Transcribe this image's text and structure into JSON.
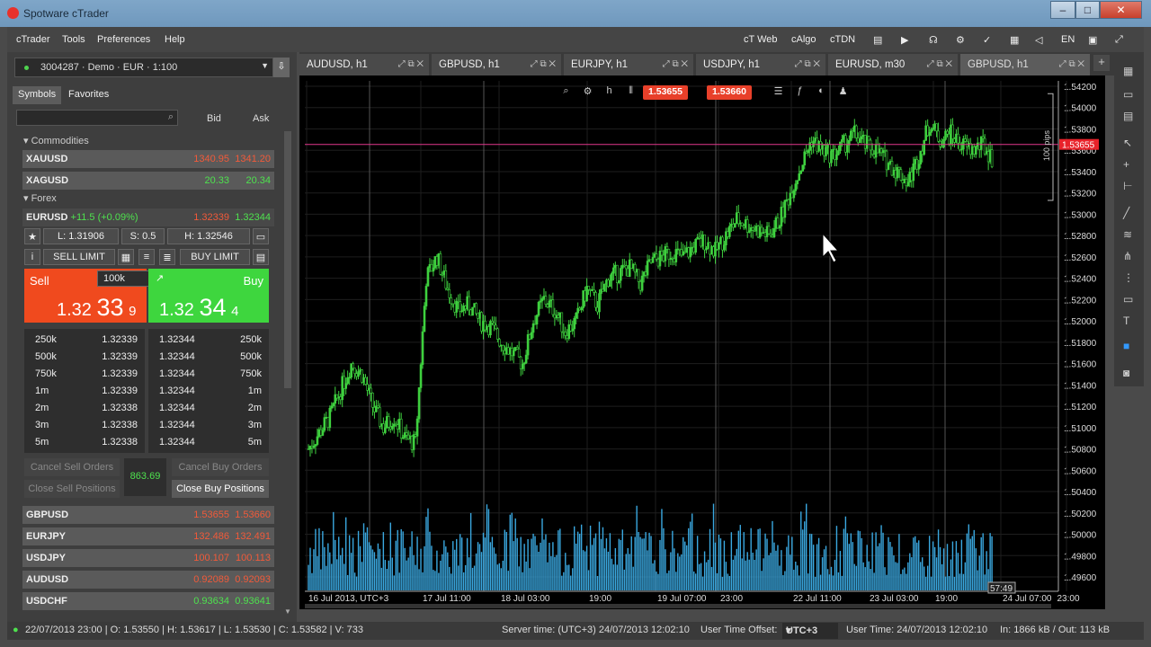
{
  "window": {
    "title": "Spotware cTrader"
  },
  "menu": {
    "left": [
      "cTrader",
      "Tools",
      "Preferences",
      "Help"
    ],
    "right": [
      "cT Web",
      "cAlgo",
      "cTDN"
    ]
  },
  "account": {
    "label": "3004287 · Demo · EUR · 1:100"
  },
  "panel_tabs": [
    "Symbols",
    "Favorites"
  ],
  "watch_headers": {
    "bid": "Bid",
    "ask": "Ask"
  },
  "groups": {
    "commodities": "Commodities",
    "forex": "Forex"
  },
  "commodities": [
    {
      "sym": "XAUUSD",
      "bid": "1340.95",
      "ask": "1341.20",
      "color": "red"
    },
    {
      "sym": "XAGUSD",
      "bid": "20.33",
      "ask": "20.34",
      "color": "grn"
    }
  ],
  "eurusd": {
    "sym": "EURUSD",
    "change": "+11.5 (+0.09%)",
    "bid": "1.32339",
    "ask": "1.32344",
    "low": "L: 1.31906",
    "spread": "S: 0.5",
    "high": "H: 1.32546",
    "sell_limit": "SELL LIMIT",
    "buy_limit": "BUY LIMIT",
    "volume": "100k",
    "sell": "Sell",
    "buy": "Buy",
    "sell_px_a": "1.32",
    "sell_px_b": "33",
    "sell_px_c": "9",
    "buy_px_a": "1.32",
    "buy_px_b": "34",
    "buy_px_c": "4"
  },
  "depth": {
    "sizes": [
      "250k",
      "500k",
      "750k",
      "1m",
      "2m",
      "3m",
      "5m"
    ],
    "bids": [
      "1.32339",
      "1.32339",
      "1.32339",
      "1.32339",
      "1.32338",
      "1.32338",
      "1.32338"
    ],
    "asks": [
      "1.32344",
      "1.32344",
      "1.32344",
      "1.32344",
      "1.32344",
      "1.32344",
      "1.32344"
    ]
  },
  "orders": {
    "cancel_sell": "Cancel Sell Orders",
    "cancel_buy": "Cancel Buy Orders",
    "close_sell": "Close Sell Positions",
    "close_buy": "Close Buy Positions",
    "pnl": "863.69"
  },
  "forex": [
    {
      "sym": "GBPUSD",
      "bid": "1.53655",
      "ask": "1.53660",
      "color": "red"
    },
    {
      "sym": "EURJPY",
      "bid": "132.486",
      "ask": "132.491",
      "color": "red"
    },
    {
      "sym": "USDJPY",
      "bid": "100.107",
      "ask": "100.113",
      "color": "red"
    },
    {
      "sym": "AUDUSD",
      "bid": "0.92089",
      "ask": "0.92093",
      "color": "red"
    },
    {
      "sym": "USDCHF",
      "bid": "0.93634",
      "ask": "0.93641",
      "color": "grn"
    }
  ],
  "chart_tabs": [
    "AUDUSD, h1",
    "GBPUSD, h1",
    "EURJPY, h1",
    "USDJPY, h1",
    "EURUSD, m30",
    "GBPUSD, h1"
  ],
  "chart_toolbar": {
    "sell_price": "1.53655",
    "buy_price": "1.53660"
  },
  "chart_data": {
    "type": "candlestick",
    "symbol": "GBPUSD",
    "timeframe": "h1",
    "y_ticks": [
      "1.54200",
      "1.54000",
      "1.53800",
      "1.53600",
      "1.53400",
      "1.53200",
      "1.53000",
      "1.52800",
      "1.52600",
      "1.52400",
      "1.52200",
      "1.52000",
      "1.51800",
      "1.51600",
      "1.51400",
      "1.51200",
      "1.51000",
      "1.50800",
      "1.50600",
      "1.50400",
      "1.50200",
      "1.50000",
      "1.49800",
      "1.49600"
    ],
    "x_ticks": [
      "16 Jul 2013, UTC+3",
      "17 Jul 11:00",
      "18 Jul 03:00",
      "19:00",
      "19 Jul 07:00",
      "23:00",
      "22 Jul 11:00",
      "23 Jul 03:00",
      "19:00",
      "24 Jul 07:00",
      "23:00"
    ],
    "current_price": "1.53655",
    "pips_label": "100 pips",
    "countdown": "57:49",
    "close_path": [
      1.508,
      1.5095,
      1.511,
      1.5135,
      1.516,
      1.515,
      1.512,
      1.51,
      1.511,
      1.509,
      1.5085,
      1.524,
      1.526,
      1.523,
      1.521,
      1.5215,
      1.52,
      1.5195,
      1.518,
      1.517,
      1.516,
      1.52,
      1.522,
      1.521,
      1.519,
      1.52,
      1.523,
      1.5215,
      1.524,
      1.5245,
      1.525,
      1.5235,
      1.5255,
      1.526,
      1.5265,
      1.526,
      1.527,
      1.5275,
      1.5265,
      1.528,
      1.5295,
      1.529,
      1.5285,
      1.528,
      1.5295,
      1.532,
      1.5345,
      1.537,
      1.536,
      1.5355,
      1.5365,
      1.5375,
      1.5365,
      1.536,
      1.535,
      1.534,
      1.533,
      1.5355,
      1.5385,
      1.537,
      1.5375,
      1.5365,
      1.536,
      1.5365,
      1.535
    ]
  },
  "right_toolbar": [
    "grid",
    "layout",
    "cursor",
    "crosshair",
    "zoom",
    "line",
    "fib",
    "pitchfork",
    "channel",
    "rect",
    "text",
    "color",
    "camera"
  ],
  "status": {
    "bar": "22/07/2013 23:00 | O: 1.53550 | H: 1.53617 | L: 1.53530 | C: 1.53582 | V: 733",
    "server": "Server time: (UTC+3) 24/07/2013 12:02:10",
    "offset_label": "User Time Offset:",
    "offset": "UTC+3",
    "user": "User Time: 24/07/2013 12:02:10",
    "io": "In: 1866 kB / Out: 113 kB"
  }
}
